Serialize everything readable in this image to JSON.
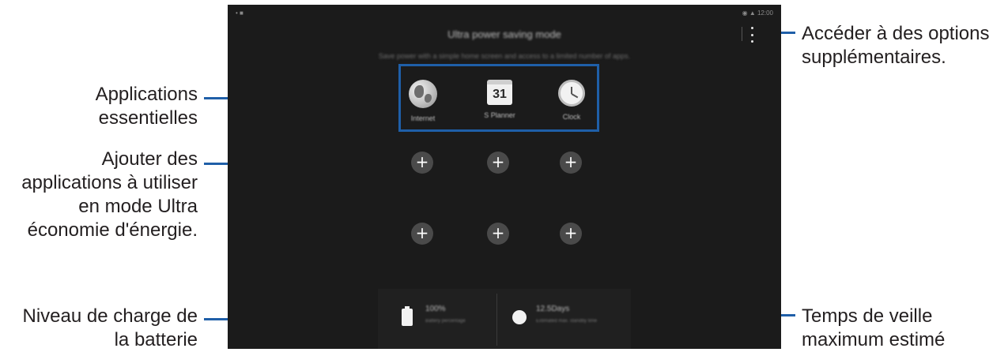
{
  "callouts": {
    "more_options": [
      "Accéder à des options",
      "supplémentaires."
    ],
    "essential_apps": [
      "Applications",
      "essentielles"
    ],
    "add_apps": [
      "Ajouter des",
      "applications à utiliser",
      "en mode Ultra",
      "économie d'énergie."
    ],
    "battery_level": [
      "Niveau de charge de",
      "la batterie"
    ],
    "standby_time": [
      "Temps de veille",
      "maximum estimé"
    ]
  },
  "screen": {
    "status_left": "• ■",
    "status_right": "◉ ▲ 12:00",
    "title": "Ultra power saving mode",
    "description": "Save power with a simple home screen and access to a limited number of apps.",
    "apps": [
      {
        "label": "Internet",
        "icon": "globe-icon"
      },
      {
        "label": "S Planner",
        "icon": "calendar-icon",
        "date": "31"
      },
      {
        "label": "Clock",
        "icon": "clock-icon"
      }
    ],
    "add_symbol": "+",
    "battery": {
      "value": "100%",
      "subtitle": "Battery percentage"
    },
    "standby": {
      "value": "12.5Days",
      "subtitle": "Estimated max. standby time"
    }
  },
  "colors": {
    "leader_line": "#1f5fa8",
    "screen_bg": "#1b1b1b",
    "callout_text": "#231f20"
  }
}
